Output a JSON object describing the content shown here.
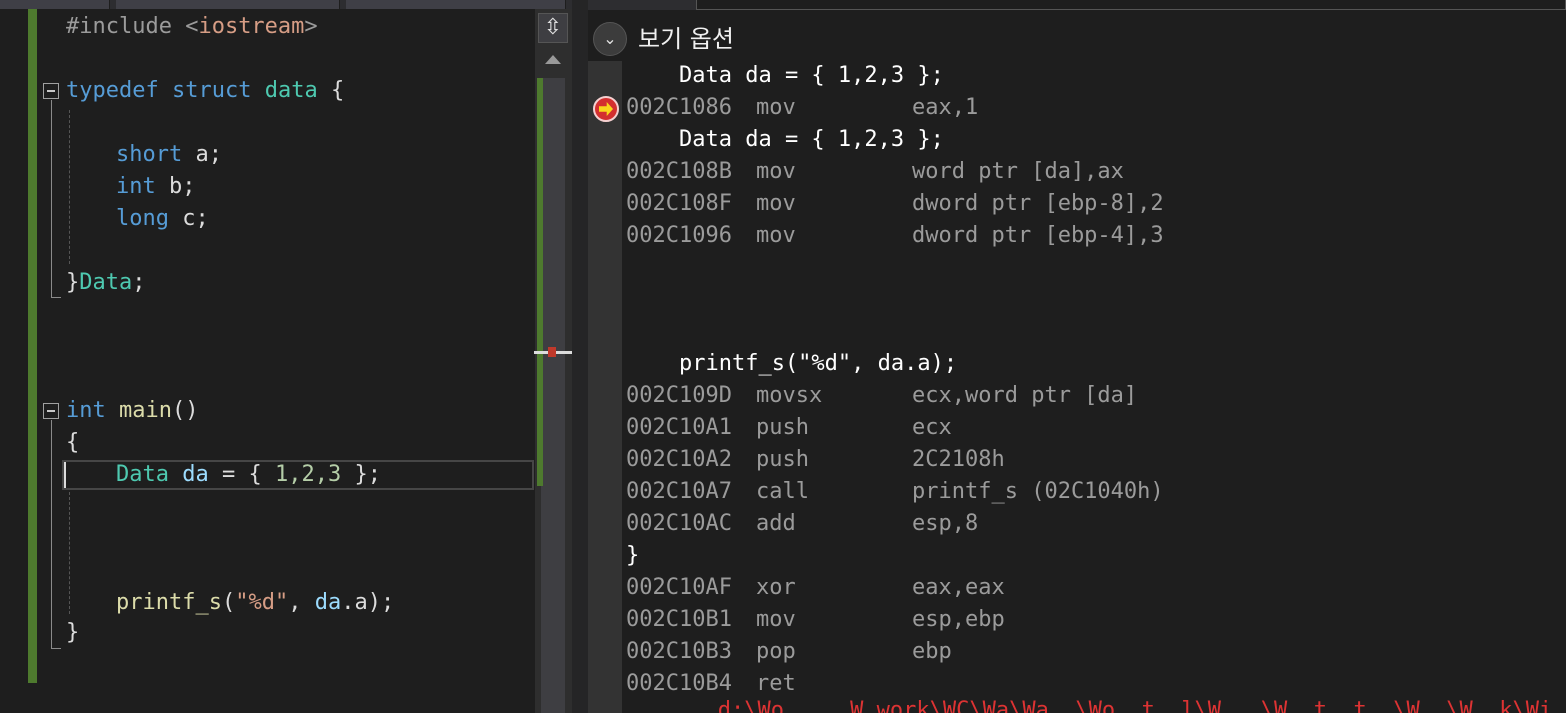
{
  "editor": {
    "lines": [
      {
        "prep": "#include <",
        "str": "iostream",
        "tail": ">"
      },
      {
        "kw1": "typedef",
        "kw2": "struct",
        "ty": "data",
        "tail": "{"
      },
      {
        "kw": "short",
        "tail": "a;"
      },
      {
        "kw": "int",
        "tail": "b;"
      },
      {
        "kw": "long",
        "tail": "c;"
      },
      {
        "head": "}",
        "ty": "Data",
        "tail": ";"
      },
      {
        "kw": "int",
        "fn": "main",
        "tail": "()"
      },
      {
        "text": "{"
      },
      {
        "ty": "Data",
        "var": "da",
        "mid": "= {",
        "nums": "1,2,3",
        "tail": "};"
      },
      {
        "fn": "printf_s",
        "open": "(",
        "str": "\"%d\"",
        "mid": ", ",
        "var": "da",
        "tail": ".a);"
      },
      {
        "text": "}"
      }
    ]
  },
  "scrollbar": {
    "split_icon": "split-icon"
  },
  "disassembly": {
    "options_label": "보기 옵션",
    "options_icon": "chevron-down-icon",
    "current_instruction_icon": "instruction-pointer-icon",
    "rows": [
      {
        "type": "src",
        "text": "    Data da = { 1,2,3 };"
      },
      {
        "type": "asm",
        "addr": "002C1086",
        "op": "mov",
        "arg": "eax,1"
      },
      {
        "type": "src",
        "text": "    Data da = { 1,2,3 };"
      },
      {
        "type": "asm",
        "addr": "002C108B",
        "op": "mov",
        "arg": "word ptr [da],ax"
      },
      {
        "type": "asm",
        "addr": "002C108F",
        "op": "mov",
        "arg": "dword ptr [ebp-8],2"
      },
      {
        "type": "asm",
        "addr": "002C1096",
        "op": "mov",
        "arg": "dword ptr [ebp-4],3"
      },
      {
        "type": "src",
        "text": "    printf_s(\"%d\", da.a);"
      },
      {
        "type": "asm",
        "addr": "002C109D",
        "op": "movsx",
        "arg": "ecx,word ptr [da]"
      },
      {
        "type": "asm",
        "addr": "002C10A1",
        "op": "push",
        "arg": "ecx"
      },
      {
        "type": "asm",
        "addr": "002C10A2",
        "op": "push",
        "arg": "2C2108h"
      },
      {
        "type": "asm",
        "addr": "002C10A7",
        "op": "call",
        "arg": "printf_s (02C1040h)"
      },
      {
        "type": "asm",
        "addr": "002C10AC",
        "op": "add",
        "arg": "esp,8"
      },
      {
        "type": "src",
        "text": "}"
      },
      {
        "type": "asm",
        "addr": "002C10AF",
        "op": "xor",
        "arg": "eax,eax"
      },
      {
        "type": "asm",
        "addr": "002C10B1",
        "op": "mov",
        "arg": "esp,ebp"
      },
      {
        "type": "asm",
        "addr": "002C10B3",
        "op": "pop",
        "arg": "ebp"
      },
      {
        "type": "asm",
        "addr": "002C10B4",
        "op": "ret",
        "arg": ""
      }
    ]
  }
}
